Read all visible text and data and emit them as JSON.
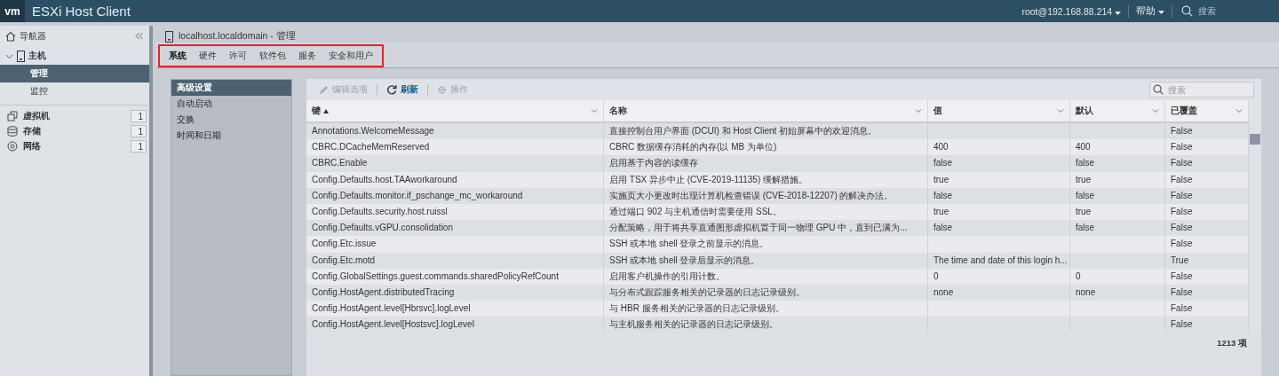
{
  "app": {
    "logo": "vm",
    "title": "ESXi Host Client",
    "user": "root@192.168.88.214",
    "help": "帮助",
    "search_placeholder": "搜索"
  },
  "sidebar": {
    "title": "导航器",
    "items": [
      {
        "kind": "host",
        "label": "主机",
        "expanded": true,
        "children": [
          {
            "label": "管理",
            "selected": true
          },
          {
            "label": "监控",
            "selected": false
          }
        ]
      },
      {
        "kind": "vm",
        "label": "虚拟机",
        "count": "1"
      },
      {
        "kind": "storage",
        "label": "存储",
        "count": "1"
      },
      {
        "kind": "network",
        "label": "网络",
        "count": "1"
      }
    ]
  },
  "page": {
    "title": "localhost.localdomain - 管理",
    "tabs": [
      {
        "label": "系统",
        "selected": true
      },
      {
        "label": "硬件",
        "selected": false
      },
      {
        "label": "许可",
        "selected": false
      },
      {
        "label": "软件包",
        "selected": false
      },
      {
        "label": "服务",
        "selected": false
      },
      {
        "label": "安全和用户",
        "selected": false
      }
    ]
  },
  "subnav": [
    {
      "label": "高级设置",
      "selected": true
    },
    {
      "label": "自动启动",
      "selected": false
    },
    {
      "label": "交换",
      "selected": false
    },
    {
      "label": "时间和日期",
      "selected": false
    }
  ],
  "toolbar": [
    {
      "kind": "edit",
      "label": "编辑选项",
      "disabled": true
    },
    {
      "kind": "refresh",
      "label": "刷新",
      "disabled": false
    },
    {
      "kind": "actions",
      "label": "操作",
      "disabled": true
    }
  ],
  "grid_search": {
    "placeholder": "搜索"
  },
  "table": {
    "columns": [
      {
        "label": "键",
        "sorted": true
      },
      {
        "label": "名称",
        "sorted": false
      },
      {
        "label": "值",
        "sorted": false
      },
      {
        "label": "默认",
        "sorted": false
      },
      {
        "label": "已覆盖",
        "sorted": false
      }
    ],
    "rows": [
      [
        "Annotations.WelcomeMessage",
        "直接控制台用户界面 (DCUI) 和 Host Client 初始屏幕中的欢迎消息。",
        "",
        "",
        "False"
      ],
      [
        "CBRC.DCacheMemReserved",
        "CBRC 数据缓存消耗的内存(以 MB 为单位)",
        "400",
        "400",
        "False"
      ],
      [
        "CBRC.Enable",
        "启用基于内容的读缓存",
        "false",
        "false",
        "False"
      ],
      [
        "Config.Defaults.host.TAAworkaround",
        "启用 TSX 异步中止 (CVE-2019-11135) 缓解措施。",
        "true",
        "true",
        "False"
      ],
      [
        "Config.Defaults.monitor.if_pschange_mc_workaround",
        "实施页大小更改时出现计算机检查错误 (CVE-2018-12207) 的解决办法。",
        "false",
        "false",
        "False"
      ],
      [
        "Config.Defaults.security.host.ruissl",
        "通过端口 902 与主机通信时需要使用 SSL。",
        "true",
        "true",
        "False"
      ],
      [
        "Config.Defaults.vGPU.consolidation",
        "分配策略，用于将共享直通图形虚拟机置于同一物理 GPU 中，直到已满为...",
        "false",
        "false",
        "False"
      ],
      [
        "Config.Etc.issue",
        "SSH 或本地 shell 登录之前显示的消息。",
        "",
        "",
        "False"
      ],
      [
        "Config.Etc.motd",
        "SSH 或本地 shell 登录后显示的消息。",
        "The time and date of this login h...",
        "",
        "True"
      ],
      [
        "Config.GlobalSettings.guest.commands.sharedPolicyRefCount",
        "启用客户机操作的引用计数。",
        "0",
        "0",
        "False"
      ],
      [
        "Config.HostAgent.distributedTracing",
        "与分布式跟踪服务相关的记录器的日志记录级别。",
        "none",
        "none",
        "False"
      ],
      [
        "Config.HostAgent.level[Hbrsvc].logLevel",
        "与 HBR 服务相关的记录器的日志记录级别。",
        "",
        "",
        "False"
      ],
      [
        "Config.HostAgent.level[Hostsvc].logLevel",
        "与主机服务相关的记录器的日志记录级别。",
        "",
        "",
        "False"
      ]
    ],
    "footer": "1213 项"
  }
}
